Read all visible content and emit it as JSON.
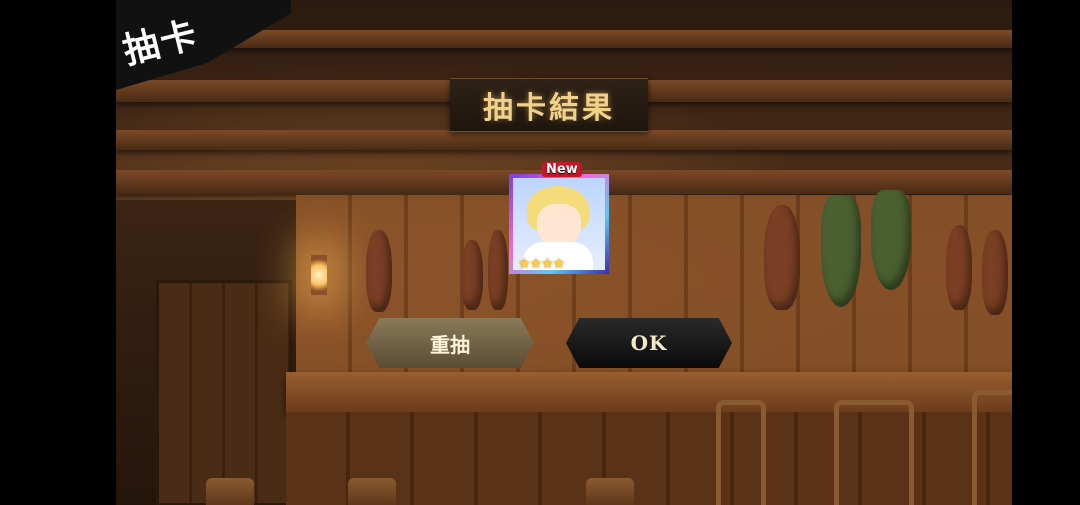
{
  "header": {
    "corner_title": "抽卡",
    "result_title": "抽卡結果"
  },
  "result": {
    "card": {
      "badge": "New",
      "stars": "★★★★",
      "rarity_stars": 4,
      "character_icon": "blonde-character-portrait"
    }
  },
  "actions": {
    "redraw_label": "重抽",
    "ok_label": "OK"
  },
  "colors": {
    "title_gold": "#f2d28a",
    "new_badge": "#c4182a",
    "star": "#ffd23a"
  }
}
